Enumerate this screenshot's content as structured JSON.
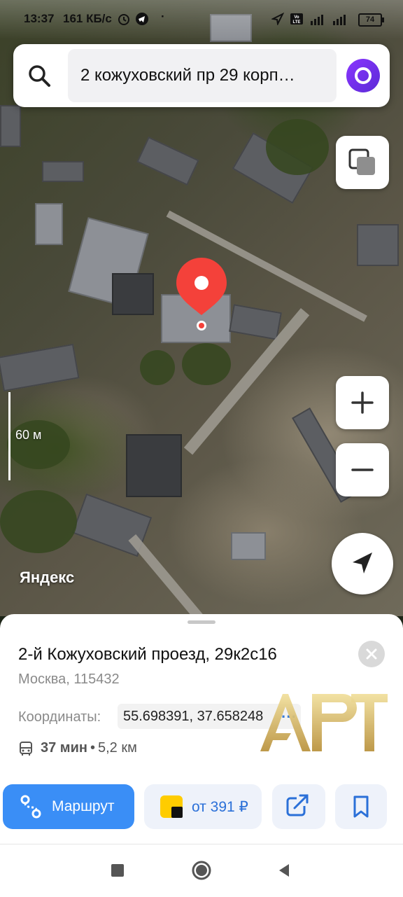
{
  "status_bar": {
    "time": "13:37",
    "network_speed": "161 КБ/с",
    "battery": "74",
    "icons": [
      "alarm-icon",
      "telegram-icon",
      "location-icon",
      "volte-icon",
      "signal-icon"
    ]
  },
  "search": {
    "query": "2 кожуховский пр 29 корп…",
    "icon": "search-icon",
    "assistant_icon": "alice-icon"
  },
  "map": {
    "scale_label": "60 м",
    "brand": "Яндекс",
    "controls": [
      "layers-icon",
      "zoom-in-icon",
      "zoom-out-icon",
      "my-location-icon"
    ]
  },
  "place": {
    "title": "2-й Кожуховский проезд, 29к2с16",
    "subtitle": "Москва, 115432",
    "coords_label": "Координаты:",
    "coords_value": "55.698391, 37.658248",
    "more": "···",
    "transit_time": "37 мин",
    "separator": "•",
    "distance": "5,2 км",
    "watermark": "АРТ"
  },
  "actions": {
    "route_label": "Маршрут",
    "taxi_label": "от 391 ₽"
  },
  "colors": {
    "accent": "#3a8ef6",
    "pin": "#f4413a",
    "alice": "#7b33f0"
  }
}
